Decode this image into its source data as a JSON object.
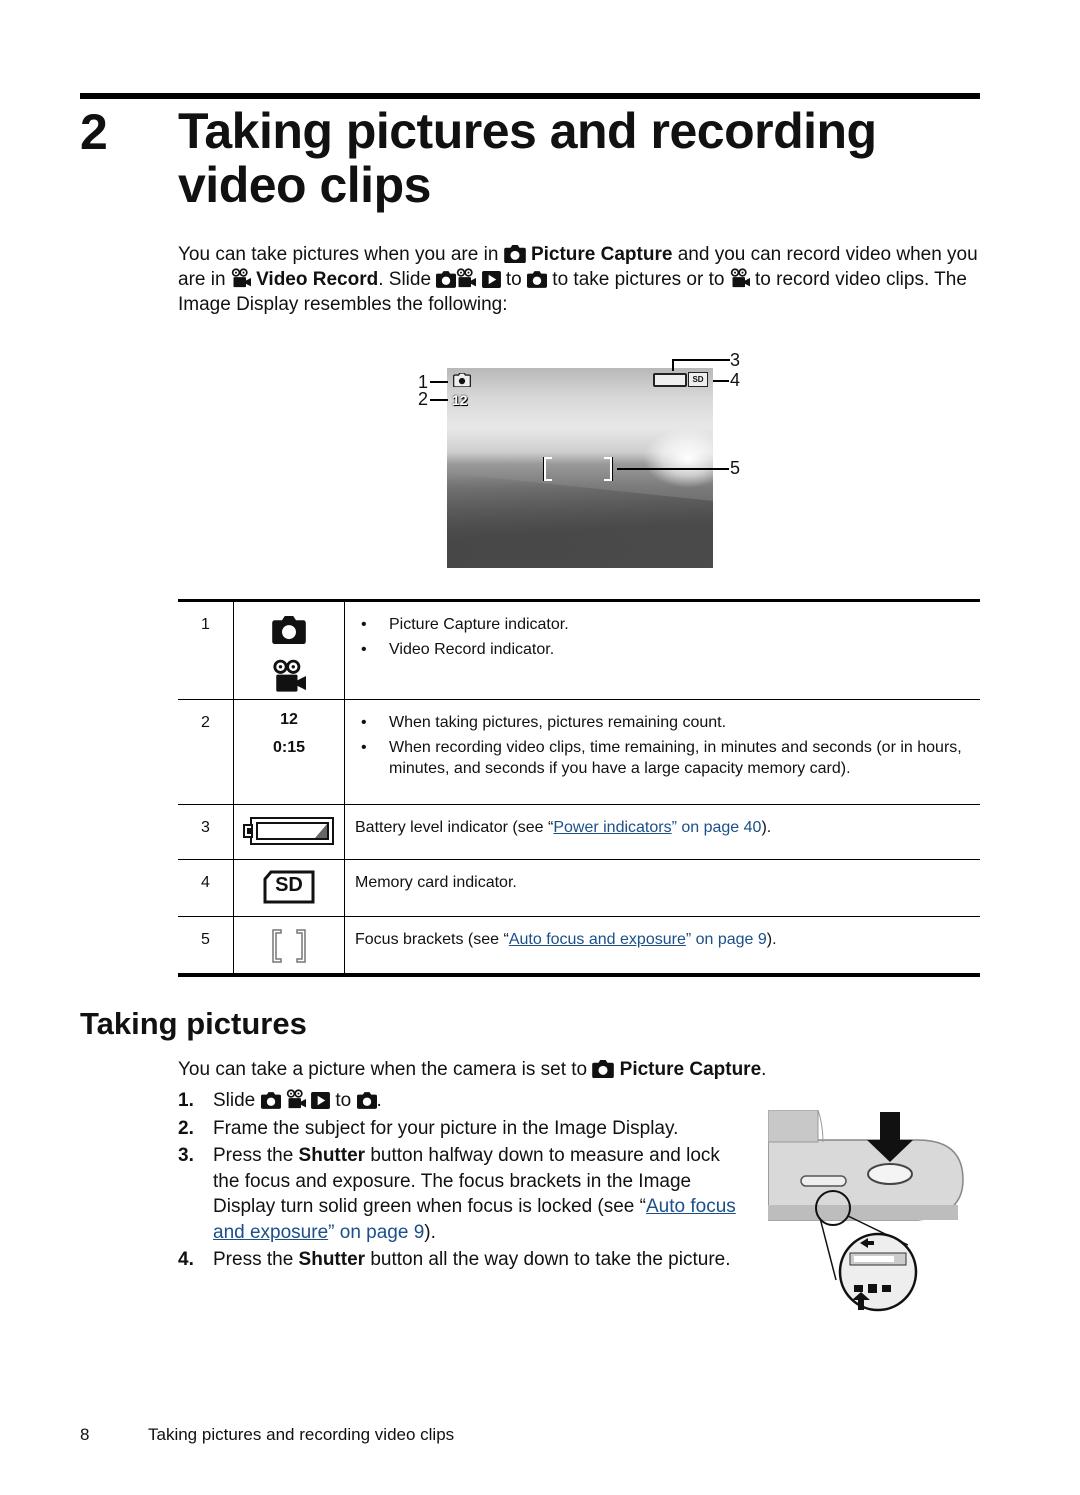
{
  "chapter": {
    "number": "2",
    "title_line1": "Taking pictures and recording",
    "title_line2": "video clips"
  },
  "intro": {
    "t1": "You can take pictures when you are in ",
    "picture_capture": "Picture Capture",
    "t2": " and you can record video when you are in ",
    "video_record": "Video Record",
    "t3": ". Slide ",
    "t4": " to ",
    "t5": " to take pictures or to ",
    "t6": " to record video clips. The Image Display resembles the following:"
  },
  "lcd_figure": {
    "remaining_count": "12",
    "sd_label": "SD",
    "callouts": [
      "1",
      "2",
      "3",
      "4",
      "5"
    ]
  },
  "table": {
    "rows": [
      {
        "num": "1",
        "icons": [
          "camera-icon",
          "video-camera-icon"
        ],
        "bullets": [
          "Picture Capture indicator.",
          "Video Record indicator."
        ]
      },
      {
        "num": "2",
        "values": [
          "12",
          "0:15"
        ],
        "bullets": [
          "When taking pictures, pictures remaining count.",
          "When recording video clips, time remaining, in minutes and seconds (or in hours, minutes, and seconds if you have a large capacity memory card)."
        ]
      },
      {
        "num": "3",
        "icon": "battery-icon",
        "desc_pre": "Battery level indicator (see “",
        "link": "Power indicators",
        "desc_post_link": "” on page 40",
        "desc_end": ")."
      },
      {
        "num": "4",
        "icon": "sd-card-icon",
        "icon_text": "SD",
        "desc": "Memory card indicator."
      },
      {
        "num": "5",
        "icon": "focus-brackets-icon",
        "desc_pre": "Focus brackets (see “",
        "link": "Auto focus and exposure",
        "desc_post_link": "” on page 9",
        "desc_end": ")."
      }
    ]
  },
  "section": {
    "title": "Taking pictures",
    "intro_pre": "You can take a picture when the camera is set to ",
    "intro_bold": "Picture Capture",
    "intro_end": ".",
    "steps": [
      {
        "n": "1.",
        "pre": "Slide ",
        "mid": " to ",
        "end": "."
      },
      {
        "n": "2.",
        "text": "Frame the subject for your picture in the Image Display."
      },
      {
        "n": "3.",
        "pre": "Press the ",
        "bold": "Shutter",
        "post": " button halfway down to measure and lock the focus and exposure. The focus brackets in the Image Display turn solid green when focus is locked (see “",
        "link": "Auto focus and exposure",
        "link_post": "” on page 9",
        "end": ")."
      },
      {
        "n": "4.",
        "pre": "Press the ",
        "bold": "Shutter",
        "post": " button all the way down to take the picture."
      }
    ]
  },
  "footer": {
    "page": "8",
    "title": "Taking pictures and recording video clips"
  },
  "colors": {
    "link": "#1b4f8a",
    "text": "#111111"
  }
}
